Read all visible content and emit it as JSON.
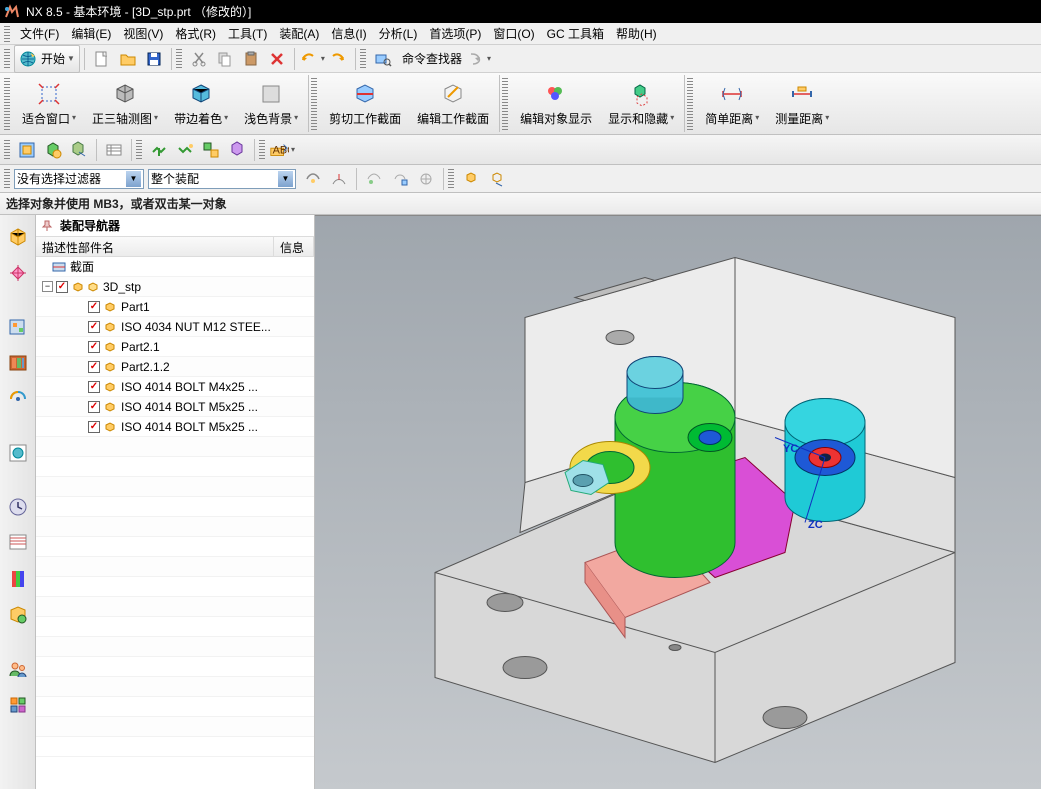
{
  "title": "NX 8.5 - 基本环境 - [3D_stp.prt （修改的）]",
  "menu": {
    "file": "文件(F)",
    "edit": "编辑(E)",
    "view": "视图(V)",
    "format": "格式(R)",
    "tools": "工具(T)",
    "assembly": "装配(A)",
    "info": "信息(I)",
    "analysis": "分析(L)",
    "prefs": "首选项(P)",
    "window": "窗口(O)",
    "gc": "GC 工具箱",
    "help": "帮助(H)"
  },
  "toolbar1": {
    "start": "开始",
    "command_finder": "命令查找器"
  },
  "ribbon": {
    "fit": "适合窗口",
    "trimetric": "正三轴测图",
    "shaded_edges": "带边着色",
    "light_bg": "浅色背景",
    "clip_section": "剪切工作截面",
    "edit_section": "编辑工作截面",
    "edit_display": "编辑对象显示",
    "show_hide": "显示和隐藏",
    "simple_dist": "简单距离",
    "measure_dist": "测量距离"
  },
  "filter": {
    "no_filter": "没有选择过滤器",
    "entire_assembly": "整个装配"
  },
  "hint": "选择对象并使用 MB3，或者双击某一对象",
  "navigator": {
    "title": "装配导航器",
    "col_name": "描述性部件名",
    "col_info": "信息",
    "root_section": "截面",
    "root_assembly": "3D_stp",
    "children": [
      "Part1",
      "ISO 4034 NUT M12 STEE...",
      "Part2.1",
      "Part2.1.2",
      "ISO 4014 BOLT M4x25 ...",
      "ISO 4014 BOLT M5x25 ...",
      "ISO 4014 BOLT M5x25 ..."
    ]
  },
  "axes": {
    "yc": "YC",
    "zc": "ZC"
  }
}
